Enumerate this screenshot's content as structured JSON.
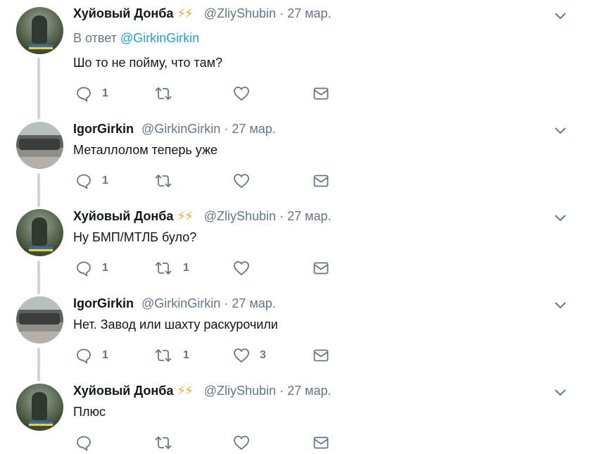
{
  "tweets": [
    {
      "name": "Хуйовый Донба",
      "bolts": "⚡⚡",
      "handle": "@ZliyShubin",
      "dot": "·",
      "date": "27 мар.",
      "reply_prefix": "В ответ",
      "reply_handle": "@GirkinGirkin",
      "text": "Шо то не пойму, что там?",
      "reply_count": "1",
      "retweet_count": "",
      "like_count": ""
    },
    {
      "name": "IgorGirkin",
      "handle": "@GirkinGirkin",
      "dot": "·",
      "date": "27 мар.",
      "text": "Металлолом теперь уже",
      "reply_count": "1",
      "retweet_count": "",
      "like_count": ""
    },
    {
      "name": "Хуйовый Донба",
      "bolts": "⚡⚡",
      "handle": "@ZliyShubin",
      "dot": "·",
      "date": "27 мар.",
      "text": "Ну БМП/МТЛБ було?",
      "reply_count": "1",
      "retweet_count": "1",
      "like_count": ""
    },
    {
      "name": "IgorGirkin",
      "handle": "@GirkinGirkin",
      "dot": "·",
      "date": "27 мар.",
      "text": "Нет. Завод или шахту раскурочили",
      "reply_count": "1",
      "retweet_count": "1",
      "like_count": "3"
    },
    {
      "name": "Хуйовый Донба",
      "bolts": "⚡⚡",
      "handle": "@ZliyShubin",
      "dot": "·",
      "date": "27 мар.",
      "text": "Плюс",
      "reply_count": "",
      "retweet_count": "",
      "like_count": ""
    }
  ],
  "colors": {
    "text": "#14171a",
    "secondary": "#657786",
    "link": "#1da1f2",
    "thread_line": "#ccd6dd",
    "bolt": "#f5a623"
  }
}
